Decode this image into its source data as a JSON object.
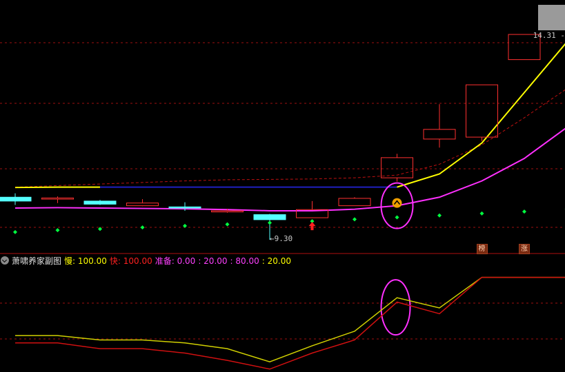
{
  "price_readout": "14.31 -",
  "low_marker": {
    "text": "9.30",
    "index": 6
  },
  "indicator": {
    "name": "萧啸养家副图",
    "params": [
      {
        "label": "慢",
        "value": "100.00",
        "color": "#ffff00"
      },
      {
        "label": "快",
        "value": "100.00",
        "color": "#ff2020"
      },
      {
        "label": "准备",
        "value": "0.00",
        "color": "#ff40ff"
      },
      {
        "label": "",
        "value": "20.00",
        "color": "#ff40ff"
      },
      {
        "label": "",
        "value": "80.00",
        "color": "#ff40ff"
      },
      {
        "label": "",
        "value": "20.00",
        "color": "#ffff00"
      }
    ]
  },
  "tags": [
    {
      "text": "榜",
      "index": 11
    },
    {
      "text": "涨",
      "index": 12
    }
  ],
  "colors": {
    "up": "#ff3030",
    "down": "#55ffff",
    "ma_yellow": "#ffff00",
    "ma_blue": "#2020c0",
    "ma_magenta": "#ff30ff",
    "ma_dashed": "#c01010",
    "dots": "#00ff40",
    "grid": "#a01010"
  },
  "chart_data": [
    {
      "type": "candlestick",
      "candles": [
        {
          "open": 10.4,
          "close": 10.3,
          "high": 10.5,
          "low": 10.2
        },
        {
          "open": 10.35,
          "close": 10.38,
          "high": 10.42,
          "low": 10.25
        },
        {
          "open": 10.3,
          "close": 10.22,
          "high": 10.33,
          "low": 10.2
        },
        {
          "open": 10.18,
          "close": 10.25,
          "high": 10.35,
          "low": 10.17
        },
        {
          "open": 10.15,
          "close": 10.12,
          "high": 10.27,
          "low": 10.05
        },
        {
          "open": 10.02,
          "close": 10.05,
          "high": 10.1,
          "low": 10.0
        },
        {
          "open": 9.95,
          "close": 9.82,
          "high": 9.97,
          "low": 9.3
        },
        {
          "open": 9.87,
          "close": 10.08,
          "high": 10.3,
          "low": 9.87
        },
        {
          "open": 10.18,
          "close": 10.37,
          "high": 10.4,
          "low": 10.18
        },
        {
          "open": 10.9,
          "close": 11.42,
          "high": 11.52,
          "low": 10.8
        },
        {
          "open": 11.9,
          "close": 12.15,
          "high": 12.8,
          "low": 11.68
        },
        {
          "open": 11.95,
          "close": 13.3,
          "high": 13.3,
          "low": 11.85
        },
        {
          "open": 13.95,
          "close": 14.6,
          "high": 14.6,
          "low": 13.95
        }
      ],
      "ma_yellow": [
        10.65,
        10.66,
        10.66,
        10.66,
        10.66,
        10.66,
        10.66,
        10.66,
        10.66,
        10.66,
        11.0,
        11.8,
        13.1,
        14.4
      ],
      "ma_magenta": [
        10.12,
        10.13,
        10.12,
        10.11,
        10.1,
        10.08,
        10.05,
        10.05,
        10.09,
        10.18,
        10.4,
        10.82,
        11.4,
        12.2
      ],
      "ma_dashed": [
        10.66,
        10.7,
        10.74,
        10.78,
        10.82,
        10.85,
        10.86,
        10.87,
        10.9,
        10.97,
        11.25,
        11.75,
        12.45,
        13.2
      ],
      "dots": [
        9.5,
        9.55,
        9.58,
        9.62,
        9.66,
        9.7,
        9.74,
        9.78,
        9.83,
        9.88,
        9.93,
        9.98,
        10.03,
        10.1
      ],
      "up_arrow_index": 7,
      "ylim": [
        9.0,
        15.4
      ]
    },
    {
      "type": "line",
      "series": [
        {
          "values": [
            40,
            40,
            37,
            37,
            35,
            31,
            22,
            33,
            43,
            66,
            59,
            80,
            80,
            80
          ]
        },
        {
          "values": [
            35,
            35,
            31,
            31,
            28,
            23,
            17,
            28,
            37,
            63,
            55,
            80,
            80,
            80
          ]
        }
      ],
      "ylim": [
        15,
        85
      ]
    }
  ]
}
